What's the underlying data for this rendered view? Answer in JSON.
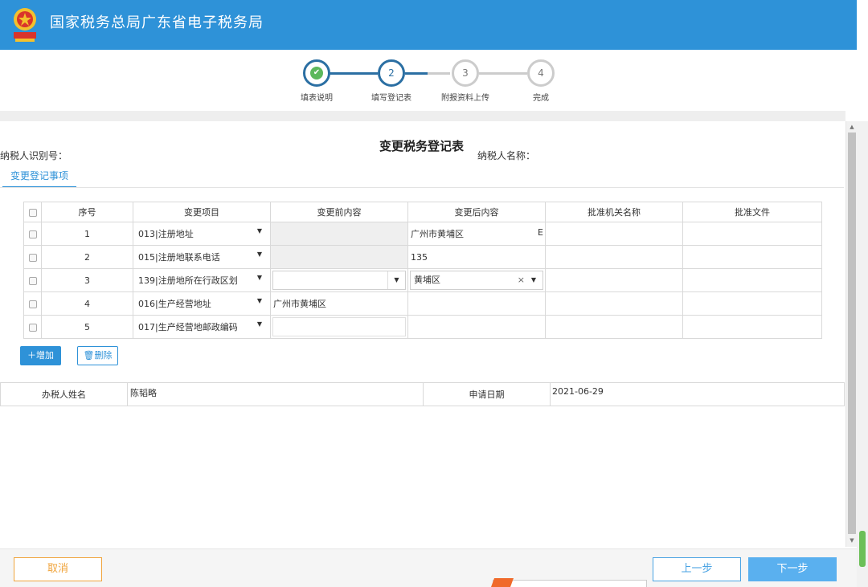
{
  "header": {
    "title": "国家税务总局广东省电子税务局",
    "background_color": "#2e92d8"
  },
  "steps": [
    {
      "number": "✔",
      "label": "填表说明",
      "state": "done"
    },
    {
      "number": "2",
      "label": "填写登记表",
      "state": "current"
    },
    {
      "number": "3",
      "label": "附报资料上传",
      "state": "pending"
    },
    {
      "number": "4",
      "label": "完成",
      "state": "pending"
    }
  ],
  "form": {
    "title": "变更税务登记表",
    "taxpayer_id_label": "纳税人识别号：",
    "taxpayer_name_label": "纳税人名称：",
    "tab_label": "变更登记事项"
  },
  "table": {
    "headers": [
      "序号",
      "变更项目",
      "变更前内容",
      "变更后内容",
      "批准机关名称",
      "批准文件"
    ],
    "rows": [
      {
        "no": "1",
        "item": "013|注册地址",
        "before": "",
        "after": "广州市黄埔区",
        "after_suffix": "E"
      },
      {
        "no": "2",
        "item": "015|注册地联系电话",
        "before": "",
        "after": "135",
        "after_suffix": ""
      },
      {
        "no": "3",
        "item": "139|注册地所在行政区划",
        "before": "",
        "after": "黄埔区",
        "after_suffix": ""
      },
      {
        "no": "4",
        "item": "016|生产经营地址",
        "before": "广州市黄埔区",
        "after": "",
        "after_suffix": ""
      },
      {
        "no": "5",
        "item": "017|生产经营地邮政编码",
        "before": "",
        "after": "",
        "after_suffix": ""
      }
    ]
  },
  "actions": {
    "add_label": "增加",
    "delete_label": "删除"
  },
  "signature": {
    "handler_label": "办税人姓名",
    "handler_value": "陈韬略",
    "date_label": "申请日期",
    "date_value": "2021-06-29"
  },
  "footer": {
    "cancel_label": "取消",
    "prev_label": "上一步",
    "next_label": "下一步"
  },
  "colors": {
    "accent": "#2e92d8",
    "cancel": "#f0a43c",
    "next": "#5ab0ef"
  }
}
